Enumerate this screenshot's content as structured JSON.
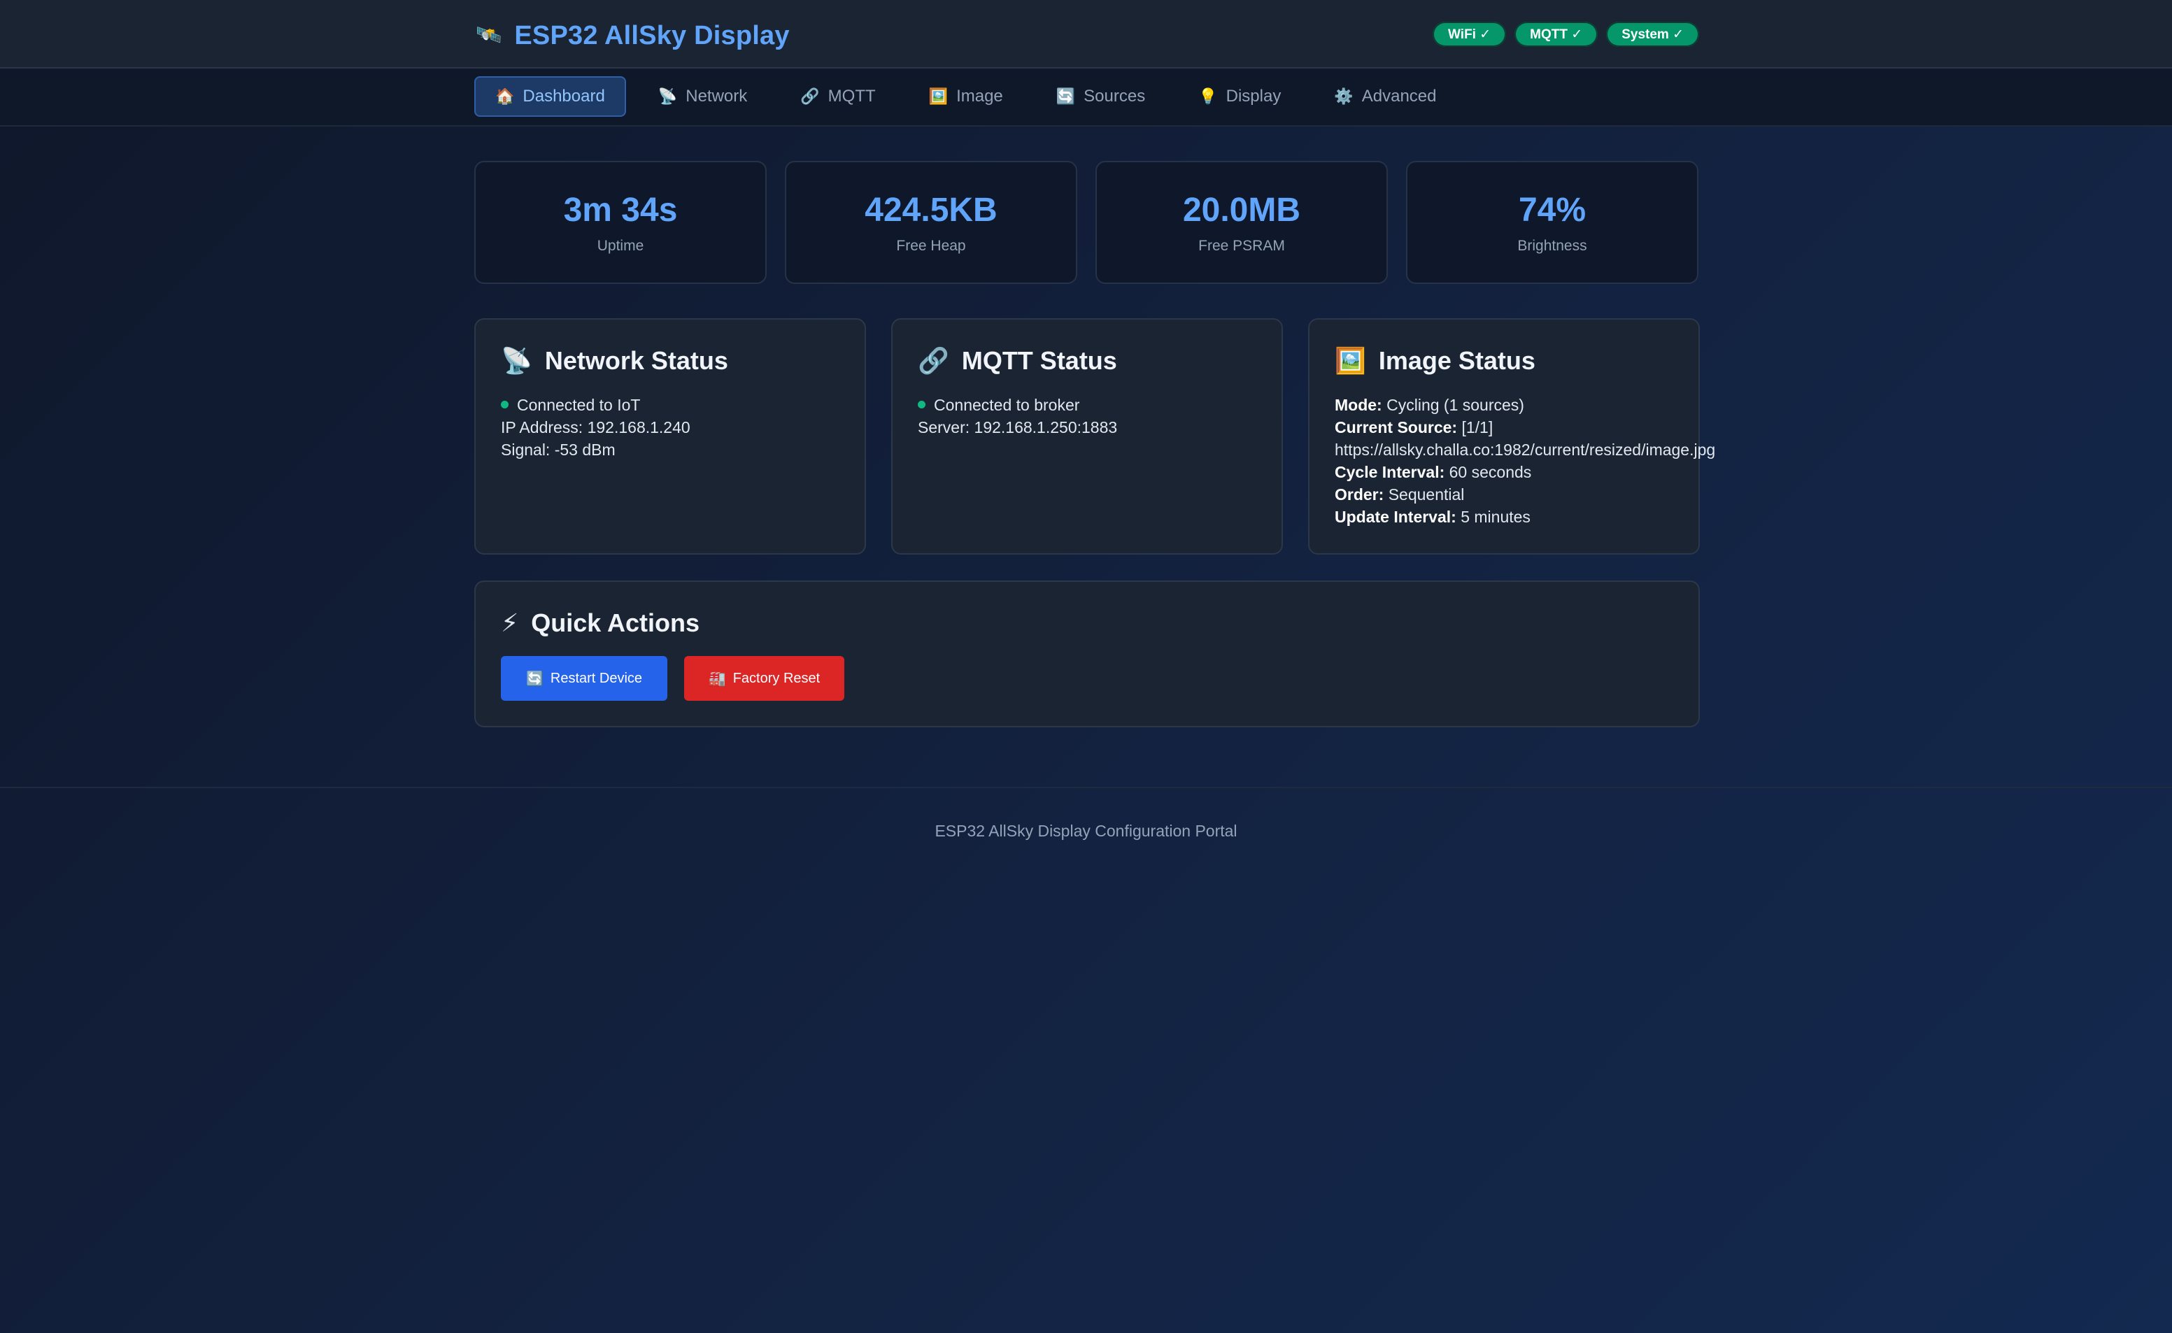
{
  "header": {
    "icon": "satellite-icon",
    "title": "ESP32 AllSky Display",
    "badges": [
      "WiFi ✓",
      "MQTT ✓",
      "System ✓"
    ],
    "badge_color": "#059669",
    "accent_color": "#60a5fa"
  },
  "nav": {
    "tabs": [
      {
        "icon": "🏠",
        "label": "Dashboard",
        "active": true
      },
      {
        "icon": "📡",
        "label": "Network",
        "active": false
      },
      {
        "icon": "🔗",
        "label": "MQTT",
        "active": false
      },
      {
        "icon": "🖼️",
        "label": "Image",
        "active": false
      },
      {
        "icon": "🔄",
        "label": "Sources",
        "active": false
      },
      {
        "icon": "💡",
        "label": "Display",
        "active": false
      },
      {
        "icon": "⚙️",
        "label": "Advanced",
        "active": false
      }
    ]
  },
  "stats": [
    {
      "value": "3m 34s",
      "label": "Uptime"
    },
    {
      "value": "424.5KB",
      "label": "Free Heap"
    },
    {
      "value": "20.0MB",
      "label": "Free PSRAM"
    },
    {
      "value": "74%",
      "label": "Brightness"
    }
  ],
  "network_status": {
    "title": "Network Status",
    "connection": "Connected to IoT",
    "ip": "IP Address: 192.168.1.240",
    "signal": "Signal: -53 dBm"
  },
  "mqtt_status": {
    "title": "MQTT Status",
    "connection": "Connected to broker",
    "server": "Server: 192.168.1.250:1883"
  },
  "image_status": {
    "title": "Image Status",
    "mode_label": "Mode:",
    "mode_value": "Cycling (1 sources)",
    "source_label": "Current Source:",
    "source_value": "[1/1]",
    "source_url": "https://allsky.challa.co:1982/current/resized/image.jpg",
    "cycle_label": "Cycle Interval:",
    "cycle_value": "60 seconds",
    "order_label": "Order:",
    "order_value": "Sequential",
    "update_label": "Update Interval:",
    "update_value": "5 minutes"
  },
  "quick_actions": {
    "title": "Quick Actions",
    "restart_icon": "🔄",
    "restart_label": "Restart Device",
    "reset_icon": "🏭",
    "reset_label": "Factory Reset"
  },
  "footer": {
    "text": "ESP32 AllSky Display Configuration Portal"
  },
  "status_colors": {
    "connected": "#10b981",
    "primary_button": "#2563eb",
    "danger_button": "#dc2626"
  }
}
